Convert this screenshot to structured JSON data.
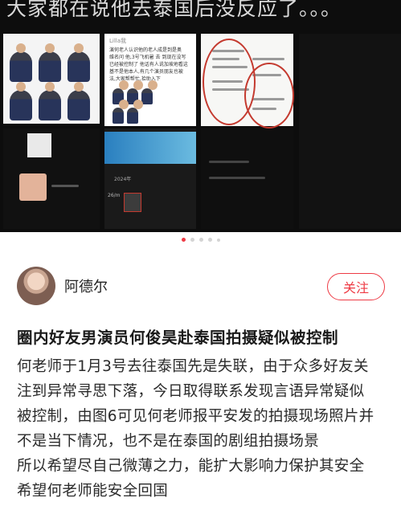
{
  "hero": {
    "caption": "大家都在说他去泰国后没反应了。。。",
    "chat_name": "Lilla我",
    "chat_lines": [
      "演何老人认识他的老人成是到是奥",
      "维名问 他,3号飞机暑 去 到现在没写",
      "已经被控制了 他话有人说加坡地看这",
      "基不是他本人,有几个演员朋友也被",
      "法,大家帮帮忙,拾助入下"
    ],
    "timestamp_label": "2024年",
    "small_label": "26/m"
  },
  "carousel": {
    "total": 5,
    "active_index": 0
  },
  "post": {
    "author_name": "阿德尔",
    "follow_label": "关注",
    "title": "圈内好友男演员何俊昊赴泰国拍摄疑似被控制",
    "body_lines": [
      "何老师于1月3号去往泰国先是失联，由于众多好友关",
      "注到异常寻思下落，今日取得联系发现言语异常疑似",
      "被控制，由图6可见何老师报平安发的拍摄现场照片并",
      "不是当下情况，也不是在泰国的剧组拍摄场景",
      "所以希望尽自己微薄之力，能扩大影响力保护其安全",
      "希望何老师能安全回国"
    ]
  },
  "colors": {
    "accent": "#ee3a44",
    "hero_bg": "#0d0d0d",
    "text": "#222222"
  }
}
